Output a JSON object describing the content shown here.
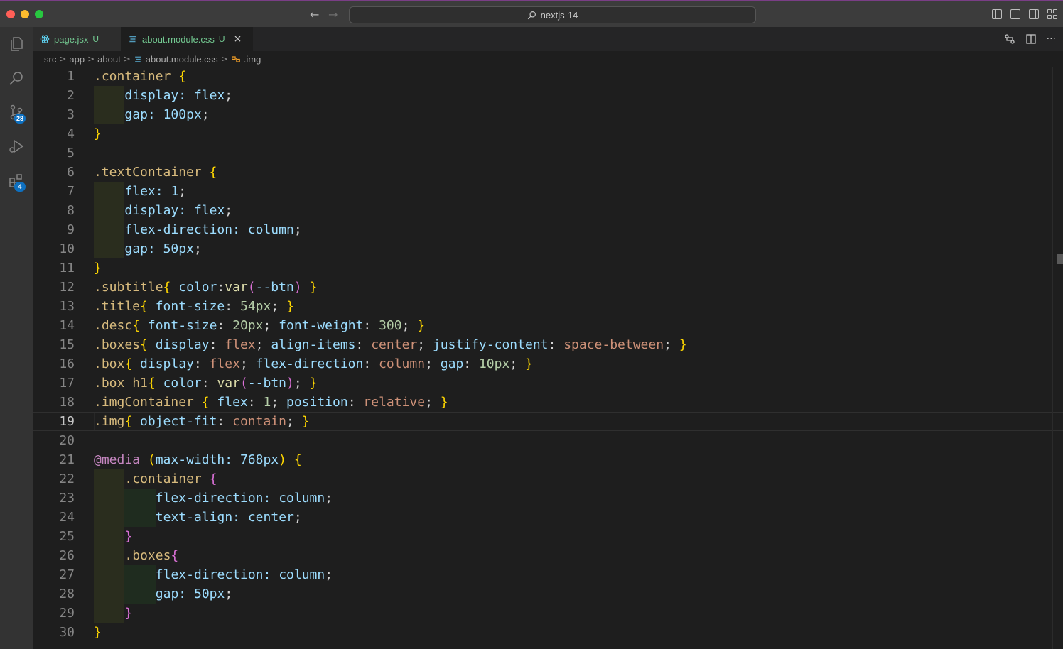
{
  "window": {
    "search_label": "nextjs-14"
  },
  "activity_bar": {
    "source_control_badge": "28",
    "extensions_badge": "4"
  },
  "tabs": [
    {
      "label": "page.jsx",
      "status": "U"
    },
    {
      "label": "about.module.css",
      "status": "U",
      "close": "×"
    }
  ],
  "breadcrumb": {
    "items": [
      "src",
      "app",
      "about",
      "about.module.css",
      ".img"
    ],
    "separator": ">"
  },
  "editor": {
    "active_line": 19,
    "line_numbers": [
      "1",
      "2",
      "3",
      "4",
      "5",
      "6",
      "7",
      "8",
      "9",
      "10",
      "11",
      "12",
      "13",
      "14",
      "15",
      "16",
      "17",
      "18",
      "19",
      "20",
      "21",
      "22",
      "23",
      "24",
      "25",
      "26",
      "27",
      "28",
      "29",
      "30"
    ],
    "lines": [
      ".container {",
      "  display: flex;",
      "  gap: 100px;",
      "}",
      "",
      ".textContainer {",
      "  flex: 1;",
      "  display: flex;",
      "  flex-direction: column;",
      "  gap: 50px;",
      "}",
      ".subtitle{ color:var(--btn) }",
      ".title{ font-size: 54px; }",
      ".desc{ font-size: 20px; font-weight: 300; }",
      ".boxes{ display: flex; align-items: center; justify-content: space-between; }",
      ".box{ display: flex; flex-direction: column; gap: 10px; }",
      ".box h1{ color: var(--btn); }",
      ".imgContainer { flex: 1; position: relative; }",
      ".img{ object-fit: contain; }",
      "",
      "@media (max-width: 768px) {",
      "  .container {",
      "    flex-direction: column;",
      "    text-align: center;",
      "  }",
      "  .boxes{",
      "    flex-direction: column;",
      "    gap: 50px;",
      "  }",
      "}"
    ]
  },
  "colors": {
    "selector": "#d7ba7d",
    "property": "#9cdcfe",
    "value": "#ce9178",
    "number": "#b5cea8",
    "at_rule": "#c586c0",
    "bracket_level1": "#ffd700",
    "bracket_level2": "#da70d6",
    "bracket_level3": "#179fff",
    "untracked": "#73c991",
    "badge": "#0e70c0"
  }
}
